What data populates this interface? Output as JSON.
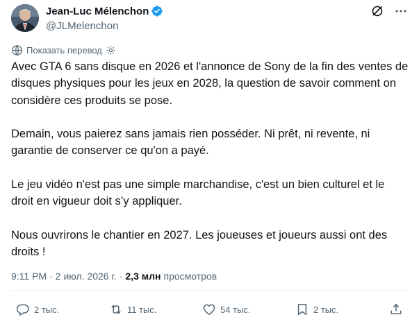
{
  "author": {
    "name": "Jean-Luc Mélenchon",
    "handle": "@JLMelenchon"
  },
  "translate": {
    "label": "Показать перевод"
  },
  "tweet": {
    "paragraphs": [
      "Avec GTA 6 sans disque en 2026 et l'annonce de Sony de la fin des ventes de disques physiques pour les jeux en 2028, la question de savoir comment on considère ces produits se pose.",
      "Demain, vous paierez sans jamais rien posséder. Ni prêt, ni revente, ni garantie de conserver ce qu'on a payé.",
      "Le jeu vidéo n'est pas une simple marchandise, c'est un bien culturel et le droit en vigueur doit s’y appliquer.",
      "Nous ouvrirons le chantier en 2027. Les joueuses et joueurs aussi ont des droits !"
    ]
  },
  "meta": {
    "time": "9:11 PM",
    "separator": "·",
    "date": "2 июл. 2026 г.",
    "views_count": "2,3 млн",
    "views_label": "просмотров"
  },
  "actions": {
    "replies": "2 тыс.",
    "reposts": "11 тыс.",
    "likes": "54 тыс.",
    "bookmarks": "2 тыс."
  },
  "colors": {
    "text": "#0f1419",
    "secondary": "#536471",
    "verified": "#1d9bf0",
    "divider": "#eff3f4"
  },
  "icons": [
    "verified-badge-icon",
    "grok-icon",
    "more-icon",
    "translate-icon",
    "settings-icon",
    "reply-icon",
    "repost-icon",
    "like-icon",
    "bookmark-icon",
    "share-icon"
  ]
}
